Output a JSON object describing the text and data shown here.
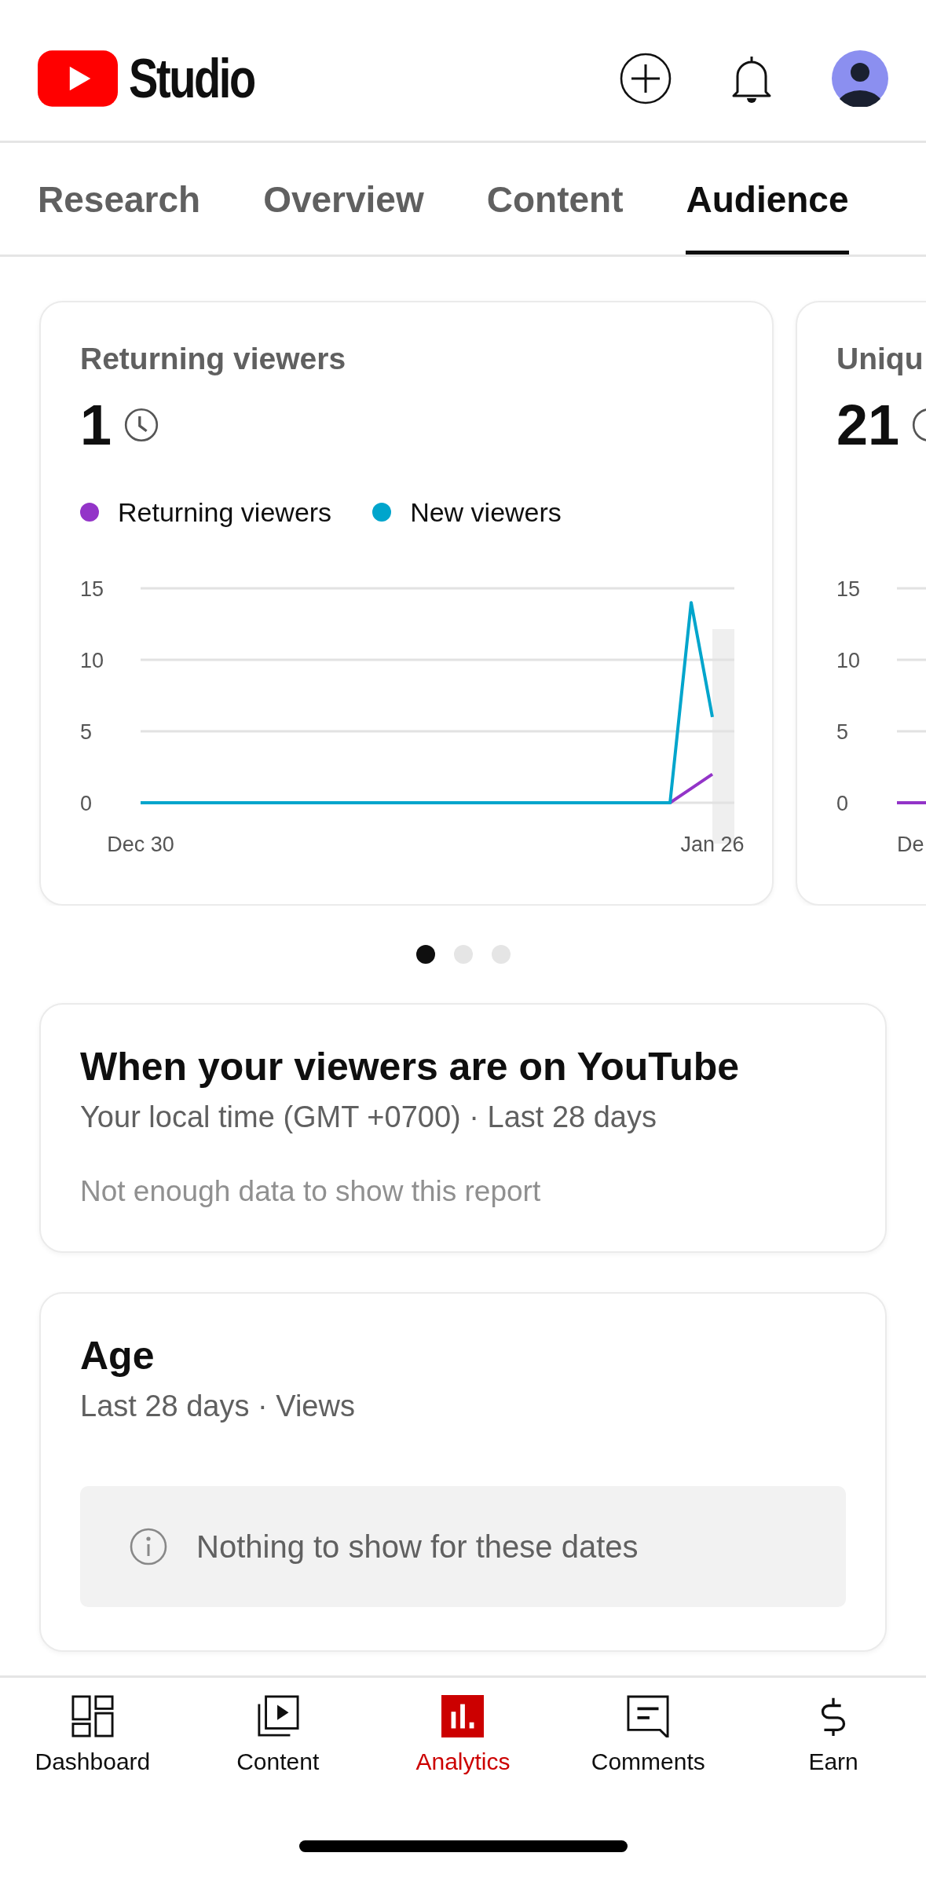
{
  "header": {
    "logo_text": "Studio"
  },
  "tabs": [
    {
      "label": "Research",
      "selected": false
    },
    {
      "label": "Overview",
      "selected": false
    },
    {
      "label": "Content",
      "selected": false
    },
    {
      "label": "Audience",
      "selected": true
    }
  ],
  "metric_cards": [
    {
      "title": "Returning viewers",
      "value": "1",
      "chart_data": {
        "type": "line",
        "categories": [
          "Dec 30",
          null,
          null,
          null,
          null,
          null,
          null,
          null,
          null,
          null,
          null,
          null,
          null,
          null,
          null,
          null,
          null,
          null,
          null,
          null,
          null,
          null,
          null,
          null,
          null,
          null,
          null,
          "Jan 26"
        ],
        "series": [
          {
            "name": "Returning viewers",
            "color": "#9334c8",
            "values": [
              null,
              null,
              null,
              null,
              null,
              null,
              null,
              null,
              null,
              null,
              null,
              null,
              null,
              null,
              null,
              null,
              null,
              null,
              null,
              null,
              null,
              null,
              null,
              null,
              null,
              0,
              1,
              2
            ]
          },
          {
            "name": "New viewers",
            "color": "#00a5cc",
            "values": [
              0,
              0,
              0,
              0,
              0,
              0,
              0,
              0,
              0,
              0,
              0,
              0,
              0,
              0,
              0,
              0,
              0,
              0,
              0,
              0,
              0,
              0,
              0,
              0,
              0,
              0,
              14,
              6
            ]
          }
        ],
        "ylim": [
          0,
          15
        ],
        "yticks": [
          0,
          5,
          10,
          15
        ]
      }
    },
    {
      "title": "Uniqu",
      "value": "21",
      "y_ticks": [
        "15",
        "10",
        "5",
        "0"
      ],
      "x_tick": "De"
    }
  ],
  "pager_dots": [
    {
      "selected": true
    },
    {
      "selected": false
    },
    {
      "selected": false
    }
  ],
  "when_card": {
    "title": "When your viewers are on YouTube",
    "subtitle": "Your local time (GMT +0700) · Last 28 days",
    "note": "Not enough data to show this report"
  },
  "age_card": {
    "title": "Age",
    "subtitle": "Last 28 days · Views",
    "empty_message": "Nothing to show for these dates"
  },
  "bottom_nav": [
    {
      "label": "Dashboard",
      "selected": false
    },
    {
      "label": "Content",
      "selected": false
    },
    {
      "label": "Analytics",
      "selected": true
    },
    {
      "label": "Comments",
      "selected": false
    },
    {
      "label": "Earn",
      "selected": false
    }
  ]
}
